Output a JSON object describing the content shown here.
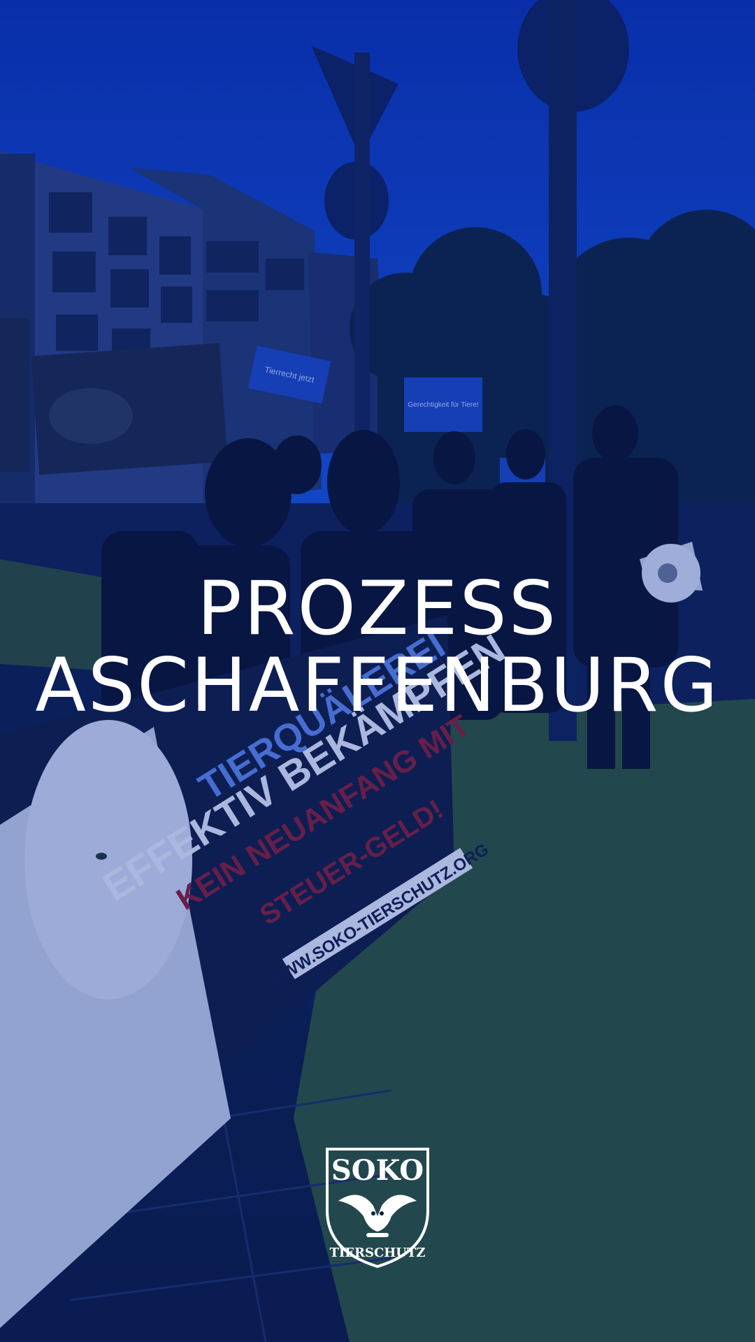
{
  "colors": {
    "sky": "#0b3fbf",
    "tint": "#0a2d9a",
    "grass": "#2f5a2c",
    "banner": "#101a3c",
    "banner_white": "#e8ecf8",
    "banner_red": "#8a1a2a",
    "text": "#ffffff"
  },
  "title": {
    "line1": "PROZESS",
    "line2": "ASCHAFFENBURG"
  },
  "banner": {
    "line1": "TIERQUÄLEREI",
    "line2": "EFFEKTIV BEKÄMPFEN",
    "line3": "KEIN NEUANFANG MIT",
    "line4": "STEUER-GELD!",
    "url": "WWW.SOKO-TIERSCHUTZ.ORG"
  },
  "signs": {
    "sign1": "Tierrecht jetzt",
    "sign2": "Gerechtigkeit für Tiere!"
  },
  "logo": {
    "top": "SOKO",
    "bottom": "TIERSCHUTZ"
  }
}
